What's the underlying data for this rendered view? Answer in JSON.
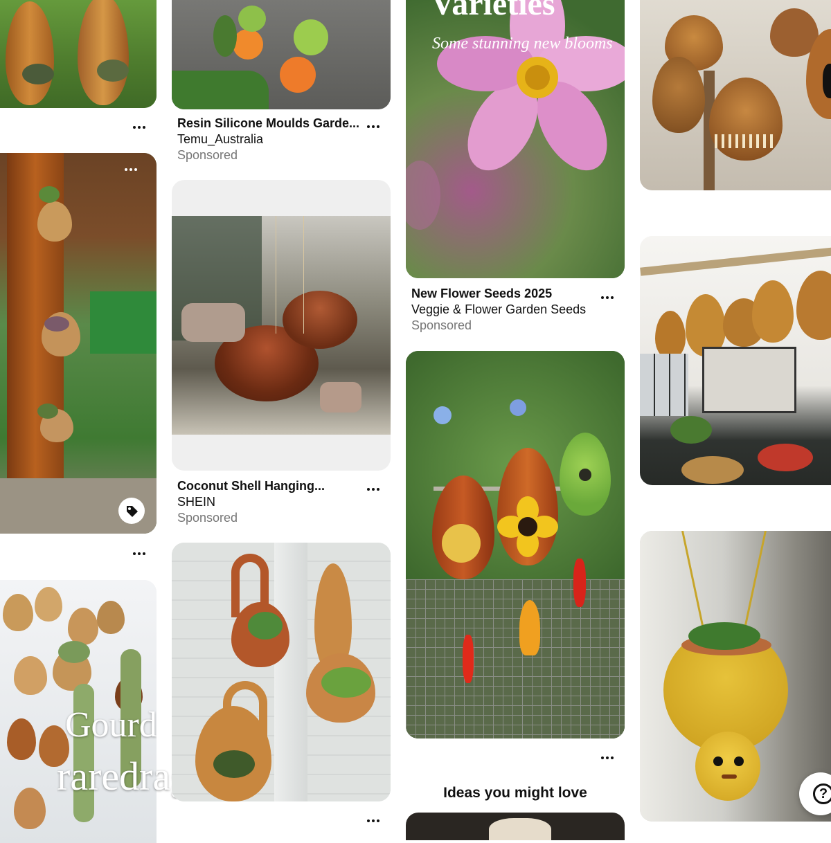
{
  "pins": {
    "resin": {
      "title": "Resin Silicone Moulds Garde...",
      "advertiser": "Temu_Australia",
      "sponsored": "Sponsored"
    },
    "coconut": {
      "title": "Coconut Shell Hanging...",
      "advertiser": "SHEIN",
      "sponsored": "Sponsored"
    },
    "seeds": {
      "overlay_heading": "Varieties",
      "overlay_script": "Some stunning new blooms",
      "title": "New Flower Seeds 2025",
      "advertiser": "Veggie & Flower Garden Seeds",
      "sponsored": "Sponsored"
    },
    "gourds_wall": {
      "watermark_line1": "Gourd",
      "watermark_line2": "raredragonfruit.com"
    }
  },
  "section": {
    "ideas_heading": "Ideas you might love"
  },
  "help": {
    "label": "?"
  },
  "icons": [
    "more-options-icon",
    "product-tag-icon",
    "help-icon"
  ],
  "colors": {
    "text": "#111111",
    "muted": "#767676",
    "background": "#ffffff"
  }
}
